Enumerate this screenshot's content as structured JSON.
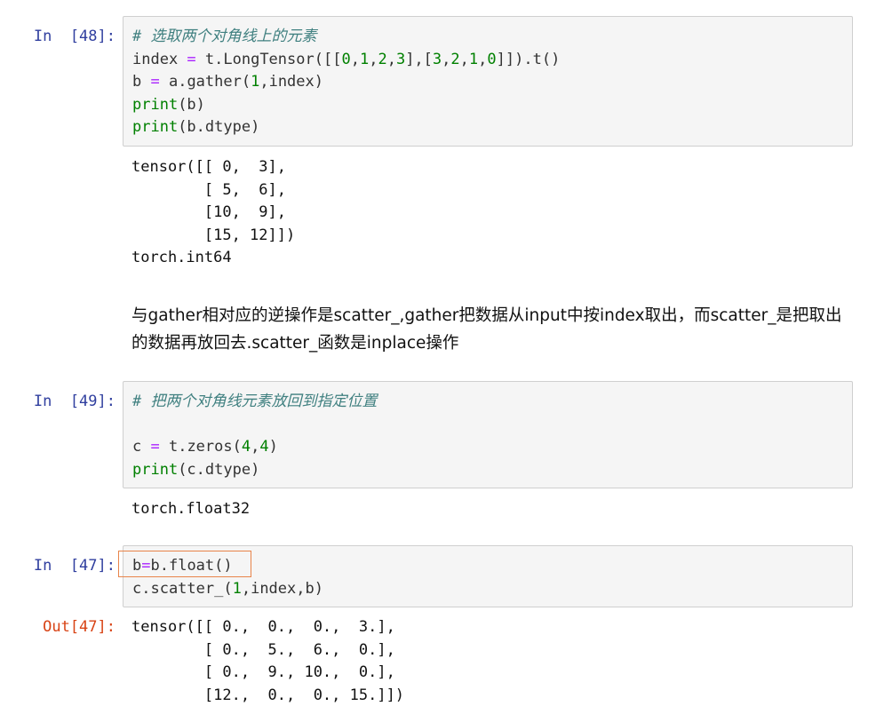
{
  "cells": {
    "c48": {
      "prompt": "In  [48]:",
      "lines": [
        [
          {
            "t": "# 选取两个对角线上的元素",
            "c": "comment"
          }
        ],
        [
          {
            "t": "index ",
            "c": "plain"
          },
          {
            "t": "=",
            "c": "op"
          },
          {
            "t": " t.LongTensor([[",
            "c": "plain"
          },
          {
            "t": "0",
            "c": "num"
          },
          {
            "t": ",",
            "c": "plain"
          },
          {
            "t": "1",
            "c": "num"
          },
          {
            "t": ",",
            "c": "plain"
          },
          {
            "t": "2",
            "c": "num"
          },
          {
            "t": ",",
            "c": "plain"
          },
          {
            "t": "3",
            "c": "num"
          },
          {
            "t": "],[",
            "c": "plain"
          },
          {
            "t": "3",
            "c": "num"
          },
          {
            "t": ",",
            "c": "plain"
          },
          {
            "t": "2",
            "c": "num"
          },
          {
            "t": ",",
            "c": "plain"
          },
          {
            "t": "1",
            "c": "num"
          },
          {
            "t": ",",
            "c": "plain"
          },
          {
            "t": "0",
            "c": "num"
          },
          {
            "t": "]]).t()",
            "c": "plain"
          }
        ],
        [
          {
            "t": "b ",
            "c": "plain"
          },
          {
            "t": "=",
            "c": "op"
          },
          {
            "t": " a.gather(",
            "c": "plain"
          },
          {
            "t": "1",
            "c": "num"
          },
          {
            "t": ",index)",
            "c": "plain"
          }
        ],
        [
          {
            "t": "print",
            "c": "builtin"
          },
          {
            "t": "(b)",
            "c": "plain"
          }
        ],
        [
          {
            "t": "print",
            "c": "builtin"
          },
          {
            "t": "(b.dtype)",
            "c": "plain"
          }
        ]
      ],
      "output": [
        "tensor([[ 0,  3],",
        "        [ 5,  6],",
        "        [10,  9],",
        "        [15, 12]])",
        "torch.int64"
      ]
    },
    "markdown": {
      "text": "与gather相对应的逆操作是scatter_,gather把数据从input中按index取出，而scatter_是把取出的数据再放回去.scatter_函数是inplace操作"
    },
    "c49": {
      "prompt": "In  [49]:",
      "lines": [
        [
          {
            "t": "# 把两个对角线元素放回到指定位置",
            "c": "comment"
          }
        ],
        [],
        [
          {
            "t": "c ",
            "c": "plain"
          },
          {
            "t": "=",
            "c": "op"
          },
          {
            "t": " t.zeros(",
            "c": "plain"
          },
          {
            "t": "4",
            "c": "num"
          },
          {
            "t": ",",
            "c": "plain"
          },
          {
            "t": "4",
            "c": "num"
          },
          {
            "t": ")",
            "c": "plain"
          }
        ],
        [
          {
            "t": "print",
            "c": "builtin"
          },
          {
            "t": "(c.dtype)",
            "c": "plain"
          }
        ]
      ],
      "output": [
        "torch.float32"
      ]
    },
    "c47": {
      "prompt": "In  [47]:",
      "out_prompt": "Out[47]:",
      "lines": [
        [
          {
            "t": "b",
            "c": "plain"
          },
          {
            "t": "=",
            "c": "op"
          },
          {
            "t": "b.float()",
            "c": "plain"
          }
        ],
        [
          {
            "t": "c.scatter_(",
            "c": "plain"
          },
          {
            "t": "1",
            "c": "num"
          },
          {
            "t": ",index,b)",
            "c": "plain"
          }
        ]
      ],
      "output": [
        "tensor([[ 0.,  0.,  0.,  3.],",
        "        [ 0.,  5.,  6.,  0.],",
        "        [ 0.,  9., 10.,  0.],",
        "        [12.,  0.,  0., 15.]])"
      ]
    }
  },
  "colors": {
    "comment": "#408080",
    "op": "#aa22ff",
    "num": "#008000",
    "builtin": "#008000",
    "in_prompt": "#303f9f",
    "out_prompt": "#d84315",
    "highlight_border": "#e8844a"
  }
}
